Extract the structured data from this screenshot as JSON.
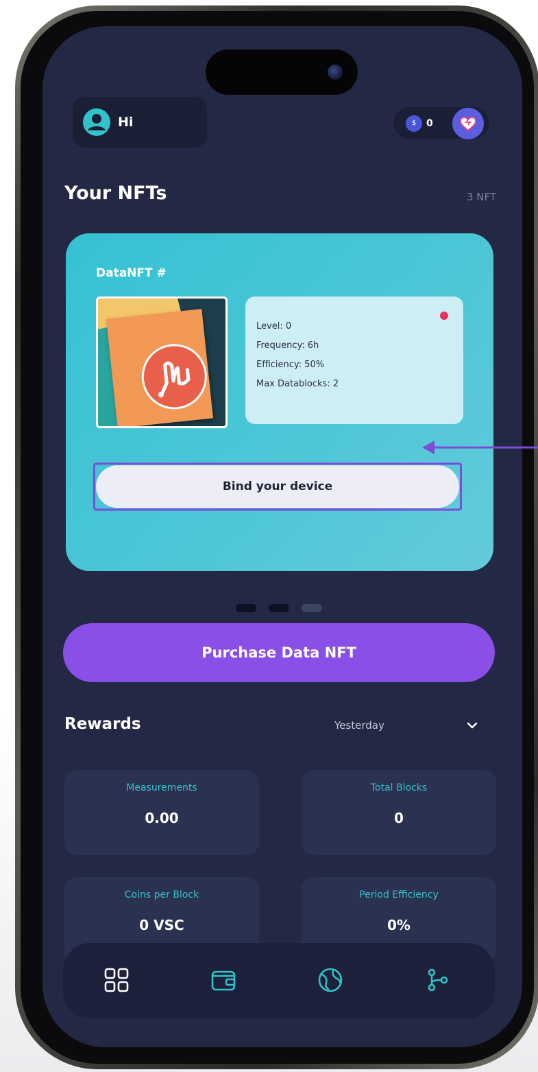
{
  "header": {
    "greeting": "Hi",
    "coin_label": "$",
    "coin_count": "0"
  },
  "nfts": {
    "title": "Your NFTs",
    "count": "3 NFT",
    "card": {
      "title": "DataNFT #",
      "status_color": "#e6325a",
      "stats": [
        "Level: 0",
        "Frequency: 6h",
        "Efficiency: 50%",
        "Max Datablocks: 2"
      ],
      "bind_button": "Bind your device"
    },
    "carousel": {
      "total": 3,
      "active_index": 2
    }
  },
  "purchase_button": "Purchase Data NFT",
  "rewards": {
    "title": "Rewards",
    "period": "Yesterday",
    "metrics": [
      {
        "label": "Measurements",
        "value": "0.00"
      },
      {
        "label": "Total Blocks",
        "value": "0"
      },
      {
        "label": "Coins per Block",
        "value": "0 VSC"
      },
      {
        "label": "Period Efficiency",
        "value": "0%"
      }
    ]
  },
  "nav": {
    "items": [
      "dashboard-icon",
      "wallet-icon",
      "globe-icon",
      "branch-icon"
    ],
    "active_color": "#33c2c9"
  },
  "colors": {
    "screen_bg": "#232844",
    "card_accent": "#35c2d3",
    "purchase_purple": "#8a4fe6",
    "highlight_purple": "#7b4dd8"
  }
}
